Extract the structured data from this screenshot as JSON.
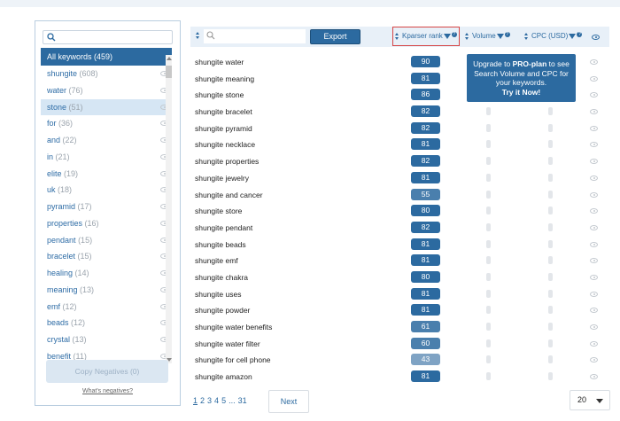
{
  "sidebar": {
    "search_placeholder": "",
    "items": [
      {
        "label": "All keywords",
        "count": "(459)"
      },
      {
        "label": "shungite",
        "count": "(608)"
      },
      {
        "label": "water",
        "count": "(76)"
      },
      {
        "label": "stone",
        "count": "(51)"
      },
      {
        "label": "for",
        "count": "(36)"
      },
      {
        "label": "and",
        "count": "(22)"
      },
      {
        "label": "in",
        "count": "(21)"
      },
      {
        "label": "elite",
        "count": "(19)"
      },
      {
        "label": "uk",
        "count": "(18)"
      },
      {
        "label": "pyramid",
        "count": "(17)"
      },
      {
        "label": "properties",
        "count": "(16)"
      },
      {
        "label": "pendant",
        "count": "(15)"
      },
      {
        "label": "bracelet",
        "count": "(15)"
      },
      {
        "label": "healing",
        "count": "(14)"
      },
      {
        "label": "meaning",
        "count": "(13)"
      },
      {
        "label": "emf",
        "count": "(12)"
      },
      {
        "label": "beads",
        "count": "(12)"
      },
      {
        "label": "crystal",
        "count": "(13)"
      },
      {
        "label": "benefit",
        "count": "(11)"
      }
    ],
    "copy_negatives": "Copy Negatives (0)",
    "whats_negatives": "What's negatives?"
  },
  "toolbar": {
    "search_placeholder": "",
    "export_label": "Export"
  },
  "columns": {
    "kparser": "Kparser rank",
    "volume": "Volume",
    "cpc": "CPC (USD)"
  },
  "promo": {
    "line1": "Upgrade to ",
    "plan": "PRO-plan",
    "line2": " to see Search Volume and CPC for your keywords.",
    "cta": "Try it Now!"
  },
  "rows": [
    {
      "keyword": "shungite water",
      "rank": "90"
    },
    {
      "keyword": "shungite meaning",
      "rank": "81"
    },
    {
      "keyword": "shungite stone",
      "rank": "86"
    },
    {
      "keyword": "shungite bracelet",
      "rank": "82"
    },
    {
      "keyword": "shungite pyramid",
      "rank": "82"
    },
    {
      "keyword": "shungite necklace",
      "rank": "81"
    },
    {
      "keyword": "shungite properties",
      "rank": "82"
    },
    {
      "keyword": "shungite jewelry",
      "rank": "81"
    },
    {
      "keyword": "shungite and cancer",
      "rank": "55"
    },
    {
      "keyword": "shungite store",
      "rank": "80"
    },
    {
      "keyword": "shungite pendant",
      "rank": "82"
    },
    {
      "keyword": "shungite beads",
      "rank": "81"
    },
    {
      "keyword": "shungite emf",
      "rank": "81"
    },
    {
      "keyword": "shungite chakra",
      "rank": "80"
    },
    {
      "keyword": "shungite uses",
      "rank": "81"
    },
    {
      "keyword": "shungite powder",
      "rank": "81"
    },
    {
      "keyword": "shungite water benefits",
      "rank": "61"
    },
    {
      "keyword": "shungite water filter",
      "rank": "60"
    },
    {
      "keyword": "shungite for cell phone",
      "rank": "43"
    },
    {
      "keyword": "shungite amazon",
      "rank": "81"
    }
  ],
  "pagination": {
    "pages": [
      "1",
      "2",
      "3",
      "4",
      "5",
      "...",
      "31"
    ],
    "next": "Next",
    "per_page": "20"
  },
  "colors": {
    "accent": "#2c6aa0",
    "rank_high": "#2c6aa0",
    "rank_mid": "#4a7fad",
    "rank_low": "#7fa3c4",
    "highlight_border": "#d64545"
  }
}
